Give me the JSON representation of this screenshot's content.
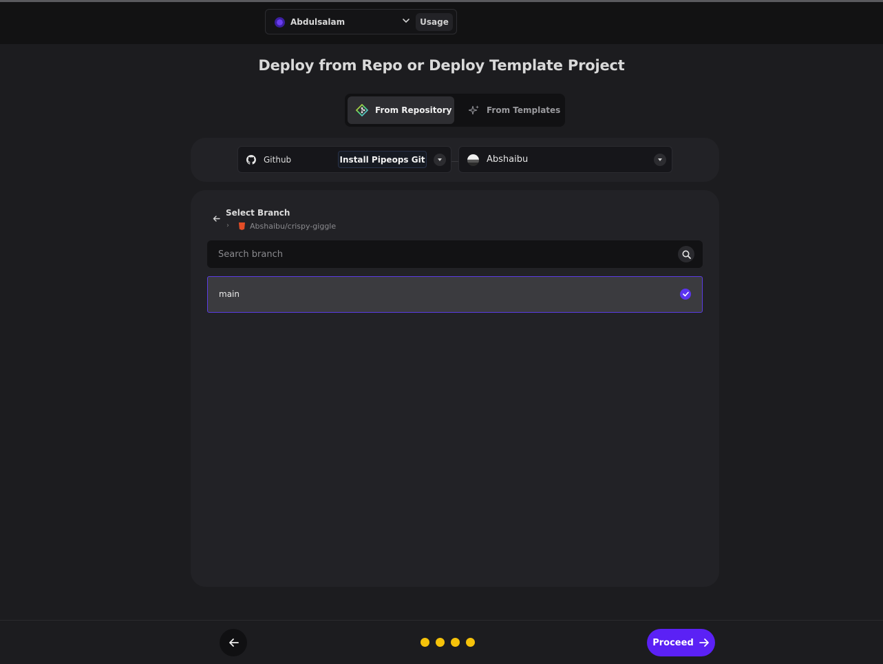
{
  "header": {
    "workspace_name": "Abdulsalam",
    "usage_label": "Usage"
  },
  "page": {
    "title": "Deploy from Repo or Deploy Template Project"
  },
  "tabs": [
    {
      "label": "From Repository",
      "active": true,
      "icon": "git-icon"
    },
    {
      "label": "From Templates",
      "active": false,
      "icon": "sparkle-icon"
    }
  ],
  "provider": {
    "name": "Github",
    "install_label": "Install Pipeops Git",
    "account_name": "Abshaibu"
  },
  "branch_panel": {
    "heading": "Select Branch",
    "repo": "Abshaibu/crispy-giggle",
    "search_placeholder": "Search branch",
    "branches": [
      {
        "name": "main",
        "selected": true
      }
    ]
  },
  "footer": {
    "proceed_label": "Proceed",
    "step_count": 4
  },
  "colors": {
    "accent": "#5b21f5",
    "step_dot": "#f5c20a",
    "selected_border": "#5b3ce6"
  }
}
